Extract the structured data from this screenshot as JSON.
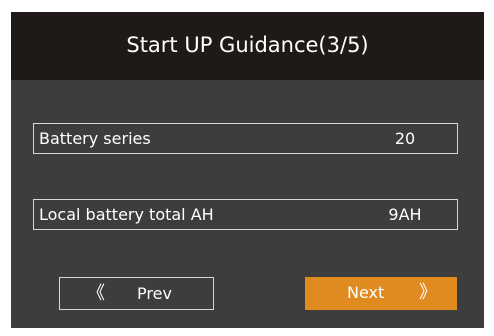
{
  "header": {
    "title": "Start UP Guidance(3/5)"
  },
  "fields": [
    {
      "label": "Battery series",
      "value": "20"
    },
    {
      "label": "Local battery total AH",
      "value": "9AH"
    }
  ],
  "nav": {
    "prev_arrow": "《",
    "prev_label": "Prev",
    "next_label": "Next",
    "next_arrow": "》"
  },
  "colors": {
    "background": "#3d3d3d",
    "header": "#1f1a17",
    "accent": "#e08b1f",
    "border": "#d7d7d7"
  }
}
